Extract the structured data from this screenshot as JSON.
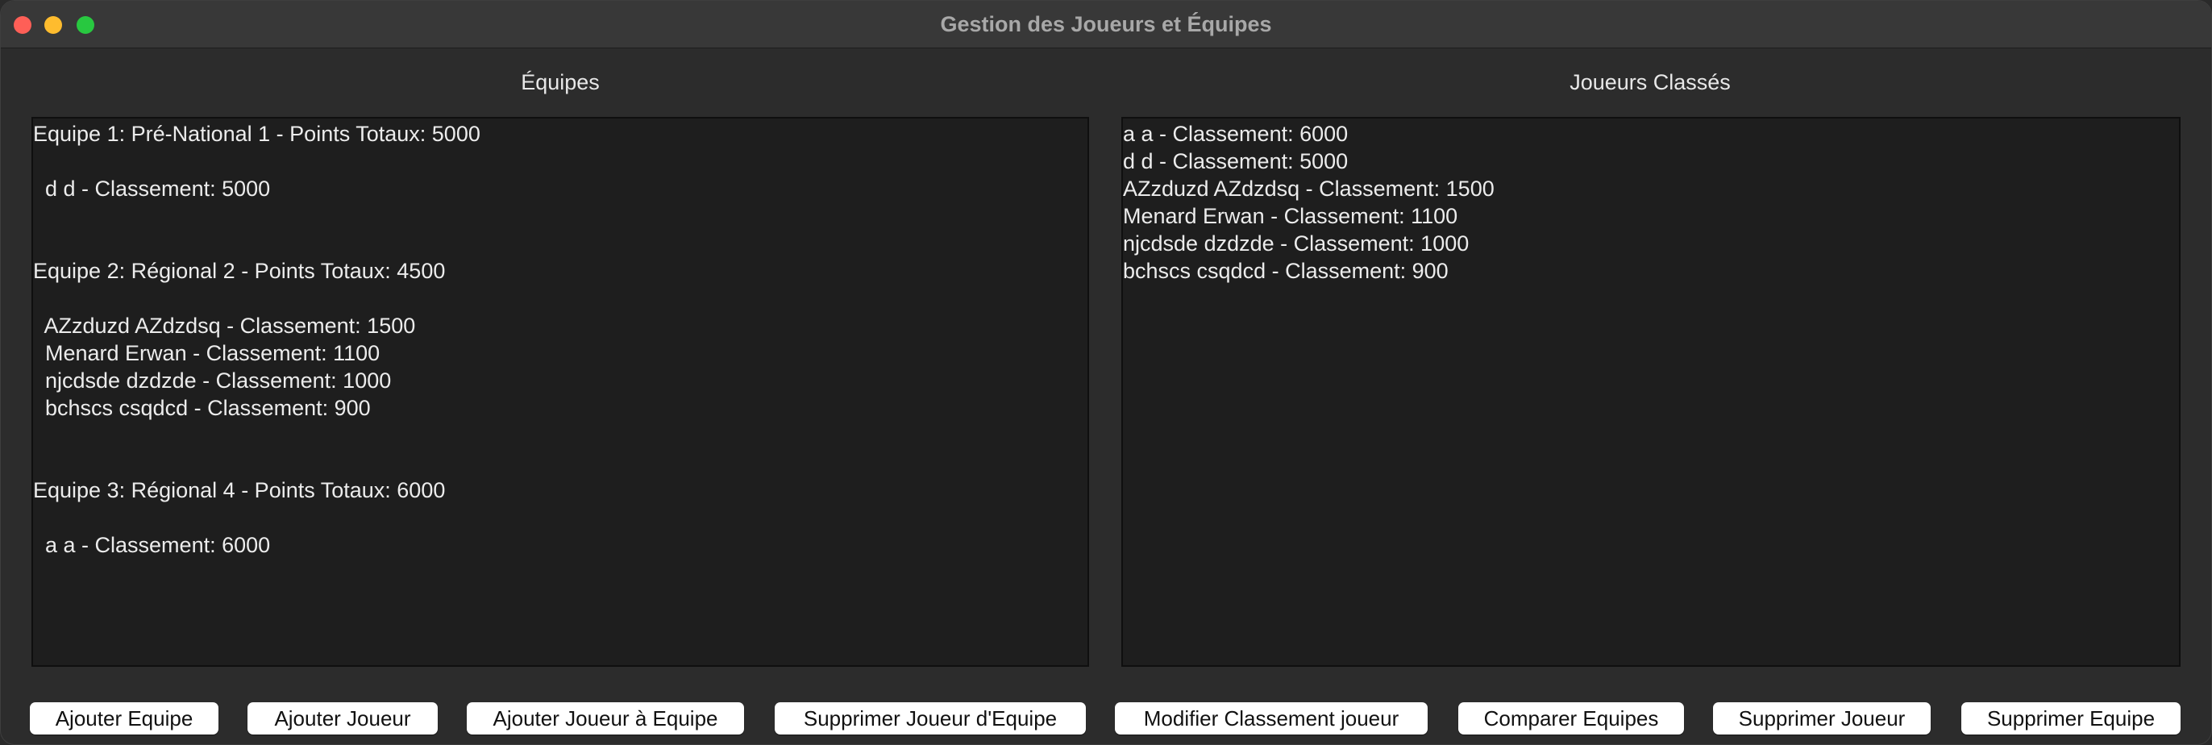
{
  "window": {
    "title": "Gestion des Joueurs et Équipes"
  },
  "teams_panel": {
    "label": "Équipes",
    "lines": [
      "Equipe 1: Pré-National 1 - Points Totaux: 5000",
      "",
      "  d d - Classement: 5000",
      "",
      "",
      "Equipe 2: Régional 2 - Points Totaux: 4500",
      "",
      "  AZzduzd AZdzdsq - Classement: 1500",
      "  Menard Erwan - Classement: 1100",
      "  njcdsde dzdzde - Classement: 1000",
      "  bchscs csqdcd - Classement: 900",
      "",
      "",
      "Equipe 3: Régional 4 - Points Totaux: 6000",
      "",
      "  a a - Classement: 6000"
    ]
  },
  "ranked_panel": {
    "label": "Joueurs Classés",
    "lines": [
      "a a - Classement: 6000",
      "d d - Classement: 5000",
      "AZzduzd AZdzdsq - Classement: 1500",
      "Menard Erwan - Classement: 1100",
      "njcdsde dzdzde - Classement: 1000",
      "bchscs csqdcd - Classement: 900"
    ]
  },
  "buttons": {
    "add_team": "Ajouter Equipe",
    "add_player": "Ajouter Joueur",
    "add_player_to_team": "Ajouter Joueur à Equipe",
    "remove_player_from_team": "Supprimer Joueur d'Equipe",
    "modify_ranking": "Modifier Classement joueur",
    "compare_teams": "Comparer Equipes",
    "delete_player": "Supprimer Joueur",
    "delete_team": "Supprimer Equipe"
  }
}
